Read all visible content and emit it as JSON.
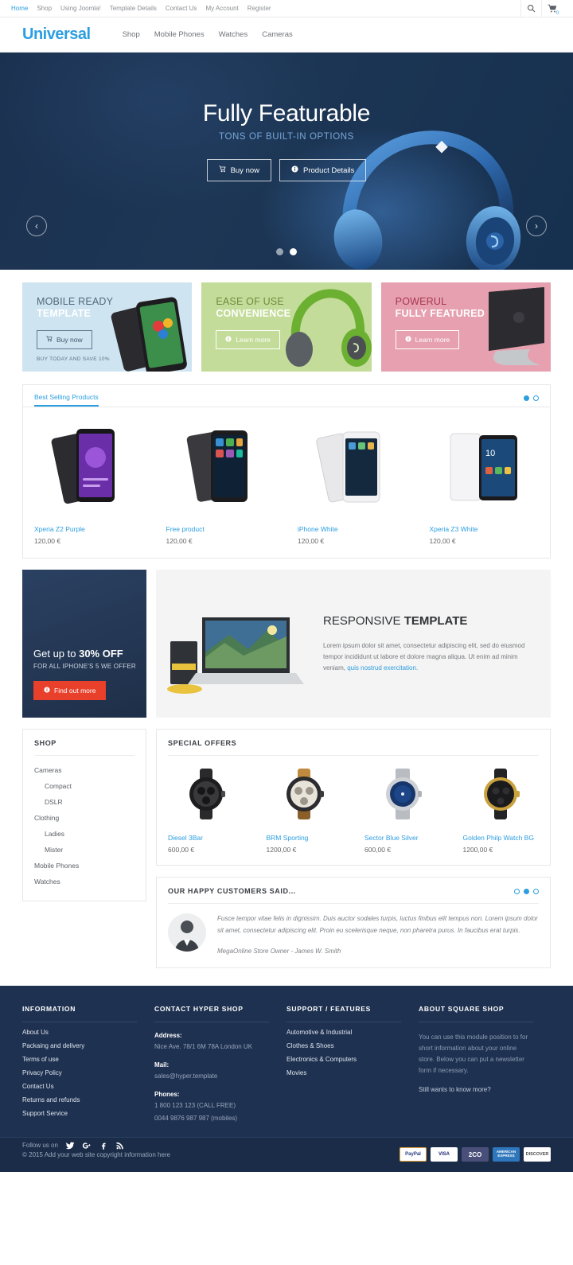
{
  "topbar": {
    "nav": [
      {
        "label": "Home",
        "active": true
      },
      {
        "label": "Shop",
        "active": false
      },
      {
        "label": "Using Joomla!",
        "active": false
      },
      {
        "label": "Template Details",
        "active": false
      },
      {
        "label": "Contact Us",
        "active": false
      },
      {
        "label": "My Account",
        "active": false
      },
      {
        "label": "Register",
        "active": false
      }
    ],
    "search_icon": "search-icon",
    "cart_icon": "cart-icon",
    "cart_count": "0"
  },
  "header": {
    "logo": "Universal",
    "nav": [
      "Shop",
      "Mobile Phones",
      "Watches",
      "Cameras"
    ]
  },
  "hero": {
    "title": "Fully Featurable",
    "subtitle": "TONS OF BUILT-IN OPTIONS",
    "buy_label": "Buy now",
    "details_label": "Product Details",
    "prev": "‹",
    "next": "›",
    "slides": 2,
    "active_slide": 2
  },
  "promos": [
    {
      "line1": "MOBILE READY",
      "line2": "TEMPLATE",
      "button": "Buy now",
      "note": "BUY TODAY AND SAVE 10%",
      "color": "#cfe4f1"
    },
    {
      "line1": "EASE OF USE",
      "line2": "CONVENIENCE",
      "button": "Learn more",
      "note": "",
      "color": "#c3dc99"
    },
    {
      "line1": "POWERUL",
      "line2": "FULLY FEATURED",
      "button": "Learn more",
      "note": "",
      "color": "#e6a0b0"
    }
  ],
  "best_selling": {
    "tab": "Best Selling Products",
    "products": [
      {
        "name": "Xperia Z2 Purple",
        "price": "120,00 €"
      },
      {
        "name": "Free product",
        "price": "120,00 €"
      },
      {
        "name": "iPhone White",
        "price": "120,00 €"
      },
      {
        "name": "Xperia Z3 White",
        "price": "120,00 €"
      }
    ],
    "dots": 2,
    "active_dot": 2
  },
  "offer": {
    "line1_pre": "Get up to ",
    "line1_strong": "30% OFF",
    "line2": "FOR ALL IPHONE'S 5 WE OFFER",
    "button": "Find out more"
  },
  "responsive": {
    "title_light": "RESPONSIVE ",
    "title_bold": "TEMPLATE",
    "body": "Lorem ipsum dolor sit amet, consectetur adipiscing elit, sed do eiusmod tempor incididunt ut labore et dolore magna aliqua. Ut enim ad minim veniam, ",
    "link": "quis nostrud exercitation."
  },
  "shop_sidebar": {
    "title": "SHOP",
    "items": [
      {
        "label": "Cameras",
        "sub": false
      },
      {
        "label": "Compact",
        "sub": true
      },
      {
        "label": "DSLR",
        "sub": true
      },
      {
        "label": "Clothing",
        "sub": false
      },
      {
        "label": "Ladies",
        "sub": true
      },
      {
        "label": "Mister",
        "sub": true
      },
      {
        "label": "Mobile Phones",
        "sub": false
      },
      {
        "label": "Watches",
        "sub": false
      }
    ]
  },
  "special_offers": {
    "title": "SPECIAL OFFERS",
    "products": [
      {
        "name": "Diesel 3Bar",
        "price": "600,00 €"
      },
      {
        "name": "BRM Sporting",
        "price": "1200,00 €"
      },
      {
        "name": "Sector Blue Silver",
        "price": "600,00 €"
      },
      {
        "name": "Golden Philp Watch BG",
        "price": "1200,00 €"
      }
    ]
  },
  "testimonial": {
    "title": "OUR HAPPY CUSTOMERS SAID...",
    "quote": "Fusce tempor vitae felis in dignissim. Duis auctor sodales turpis, luctus finibus elit tempus non. Lorem ipsum dolor sit amet, consectetur adipiscing elit. Proin eu scelerisque neque, non pharetra purus. In faucibus erat turpis.",
    "author": "MegaOnline Store Owner - James W. Smith",
    "dots": 3,
    "active_dot": 2
  },
  "footer": {
    "information": {
      "title": "INFORMATION",
      "links": [
        "About Us",
        "Packaing and delivery",
        "Terms of use",
        "Privacy Policy",
        "Contact Us",
        "Returns and refunds",
        "Support Service"
      ]
    },
    "contact": {
      "title": "CONTACT HYPER SHOP",
      "address_label": "Address:",
      "address_value": "Nice Ave. 78/1 6M 78A London UK",
      "mail_label": "Mail:",
      "mail_value": "sales@hyper.template",
      "phones_label": "Phones:",
      "phone1": "1 800 123 123 (CALL FREE)",
      "phone2": "0044 9876 987 987 (mobiles)"
    },
    "support": {
      "title": "SUPPORT / FEATURES",
      "links": [
        "Automotive & Industrial",
        "Clothes & Shoes",
        "Electronics & Computers",
        "Movies"
      ]
    },
    "about": {
      "title": "ABOUT SQUARE SHOP",
      "text": "You can use this module position to for short information about your online store. Below you can put a newsletter form if necessary.",
      "more": "Still wants to know more?"
    },
    "social_label": "Follow us on",
    "social_icons": [
      "twitter-icon",
      "google-plus-icon",
      "facebook-icon",
      "rss-icon"
    ],
    "copyright": "© 2015 Add your web site copyright information here",
    "payments": [
      "PayPal",
      "VISA",
      "2CO",
      "AMERICAN EXPRESS",
      "DISCOVER"
    ]
  }
}
